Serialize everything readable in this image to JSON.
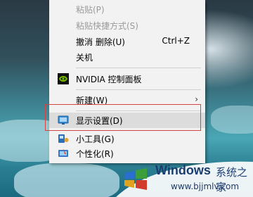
{
  "context_menu": {
    "items": [
      {
        "label": "粘贴(P)",
        "disabled": true
      },
      {
        "label": "粘贴快捷方式(S)",
        "disabled": true
      },
      {
        "label": "撤消 删除(U)",
        "shortcut": "Ctrl+Z"
      },
      {
        "label": "关机"
      },
      {
        "label": "NVIDIA 控制面板",
        "icon": "nvidia-icon"
      },
      {
        "label": "新建(W)",
        "submenu": true
      },
      {
        "label": "显示设置(D)",
        "icon": "display-settings-icon",
        "highlighted": true
      },
      {
        "label": "小工具(G)",
        "icon": "gadgets-icon"
      },
      {
        "label": "个性化(R)",
        "icon": "personalize-icon"
      }
    ],
    "submenu_arrow": "›"
  },
  "watermark": {
    "brand": "Windows",
    "brand_cn": "系统之家",
    "url": "www.bjjmlv.com"
  },
  "colors": {
    "highlight_border": "#d04545",
    "nvidia_green": "#76b900",
    "menu_bg": "#f2f2f2"
  }
}
